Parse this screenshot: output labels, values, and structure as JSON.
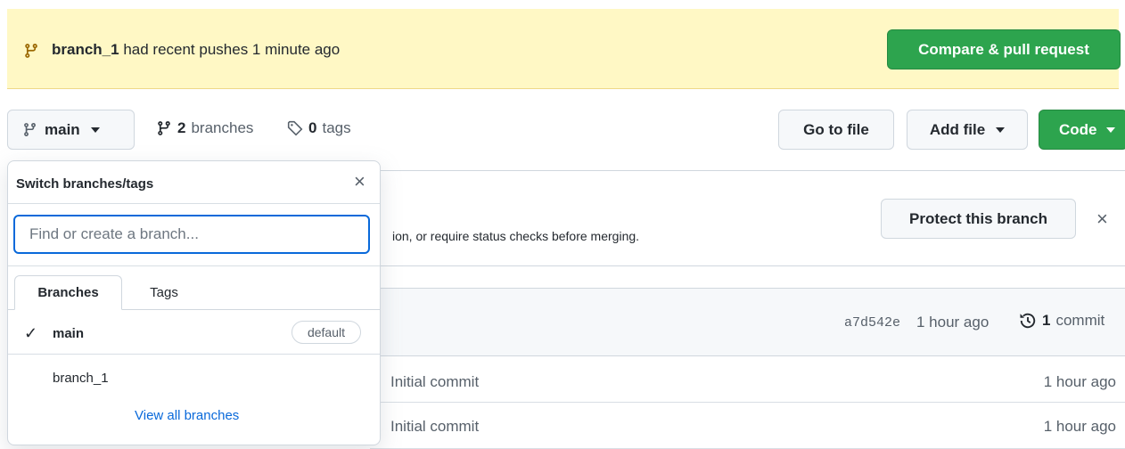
{
  "banner": {
    "branch": "branch_1",
    "message": " had recent pushes 1 minute ago",
    "compare_label": "Compare & pull request"
  },
  "repo_bar": {
    "current_branch": "main",
    "branches_count": "2",
    "branches_label": "branches",
    "tags_count": "0",
    "tags_label": "tags",
    "goto_file": "Go to file",
    "add_file": "Add file",
    "code": "Code"
  },
  "protect": {
    "text_fragment": "ion, or require status checks before merging.",
    "button": "Protect this branch",
    "close": "×"
  },
  "latest_commit": {
    "hash": "a7d542e",
    "time": "1 hour ago",
    "count": "1",
    "count_label": "commit"
  },
  "files": [
    {
      "message": "Initial commit",
      "time": "1 hour ago"
    },
    {
      "message": "Initial commit",
      "time": "1 hour ago"
    }
  ],
  "dropdown": {
    "title": "Switch branches/tags",
    "close": "×",
    "filter_placeholder": "Find or create a branch...",
    "tabs": [
      "Branches",
      "Tags"
    ],
    "items": [
      {
        "name": "main",
        "checked": "✓",
        "badge": "default"
      },
      {
        "name": "branch_1"
      }
    ],
    "view_all": "View all branches"
  },
  "colors": {
    "banner_bg": "#fff8c5",
    "accent_green": "#2da44e",
    "link_blue": "#0969da"
  }
}
